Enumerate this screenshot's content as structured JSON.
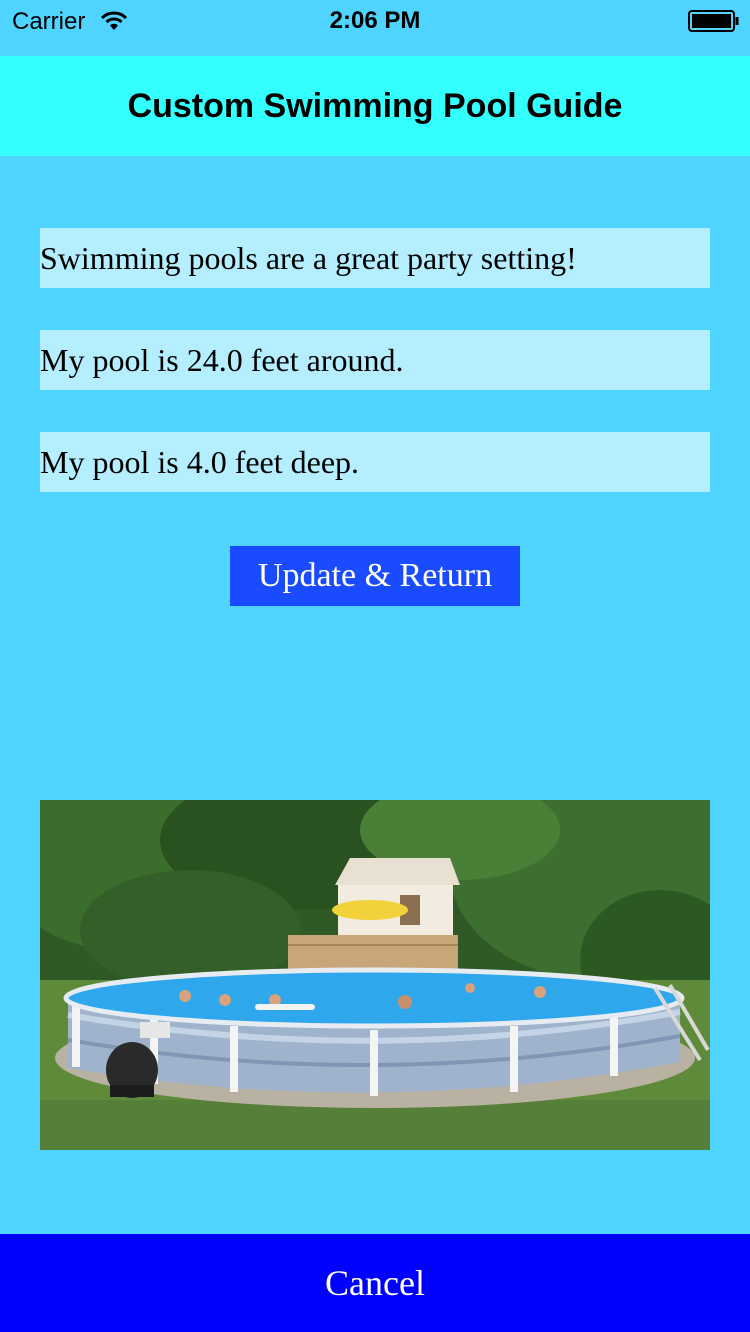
{
  "status_bar": {
    "carrier": "Carrier",
    "time": "2:06 PM",
    "wifi_icon": "wifi-icon",
    "battery_icon": "battery-icon"
  },
  "nav": {
    "title": "Custom Swimming Pool Guide"
  },
  "fields": {
    "description": "Swimming pools are a great party setting!",
    "circumference": "My pool is 24.0 feet around.",
    "depth": "My pool is 4.0 feet deep."
  },
  "buttons": {
    "update_label": "Update & Return",
    "cancel_label": "Cancel"
  },
  "image": {
    "subject": "above-ground swimming pool photo"
  },
  "colors": {
    "background": "#4fd3ff",
    "nav_bar": "#33ffff",
    "field_bg": "#b4eeff",
    "update_button": "#1a4bff",
    "cancel_bar": "#0000ff"
  }
}
